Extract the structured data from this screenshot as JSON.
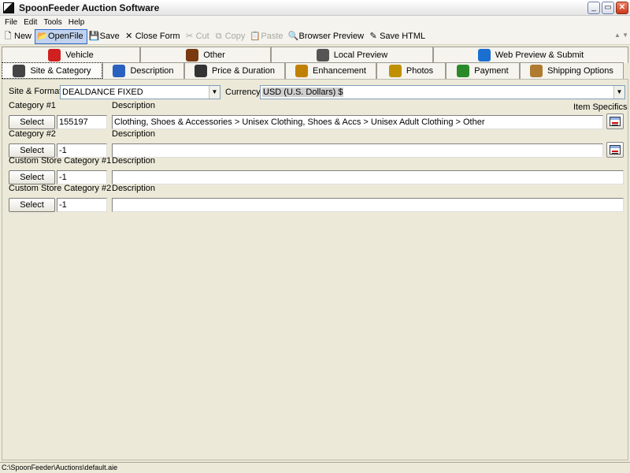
{
  "window": {
    "title": "SpoonFeeder Auction Software",
    "controls": [
      "_",
      "▭",
      "✕"
    ]
  },
  "menu": [
    "File",
    "Edit",
    "Tools",
    "Help"
  ],
  "toolbar": {
    "items": [
      {
        "label": "New",
        "icon": "new-document-icon",
        "glyph": "🗋",
        "state": "normal"
      },
      {
        "label": "OpenFile",
        "icon": "open-folder-icon",
        "glyph": "📂",
        "state": "active"
      },
      {
        "label": "Save",
        "icon": "save-disk-icon",
        "glyph": "💾",
        "state": "normal"
      },
      {
        "label": "Close Form",
        "icon": "close-x-icon",
        "glyph": "✕",
        "state": "normal"
      },
      {
        "label": "Cut",
        "icon": "scissors-icon",
        "glyph": "✂",
        "state": "disabled"
      },
      {
        "label": "Copy",
        "icon": "copy-icon",
        "glyph": "⧉",
        "state": "disabled"
      },
      {
        "label": "Paste",
        "icon": "paste-icon",
        "glyph": "📋",
        "state": "disabled"
      },
      {
        "label": "Browser Preview",
        "icon": "browser-preview-icon",
        "glyph": "🔍",
        "state": "normal"
      },
      {
        "label": "Save HTML",
        "icon": "save-html-icon",
        "glyph": "✎",
        "state": "normal"
      }
    ]
  },
  "tabs_row1": [
    {
      "label": "Vehicle",
      "icon": "car-icon",
      "color": "#d02020"
    },
    {
      "label": "Other",
      "icon": "barcode-icon",
      "color": "#7a3a10"
    },
    {
      "label": "Local Preview",
      "icon": "book-icon",
      "color": "#555555"
    },
    {
      "label": "Web Preview & Submit",
      "icon": "globe-icon",
      "color": "#1a6fd0"
    }
  ],
  "tabs_row2": [
    {
      "label": "Site & Category",
      "icon": "tree-icon",
      "color": "#444444",
      "selected": true
    },
    {
      "label": "Description",
      "icon": "edit-document-icon",
      "color": "#2a60c0",
      "selected": false
    },
    {
      "label": "Price & Duration",
      "icon": "clock-icon",
      "color": "#333333",
      "selected": false
    },
    {
      "label": "Enhancement",
      "icon": "magic-wand-icon",
      "color": "#c08000",
      "selected": false
    },
    {
      "label": "Photos",
      "icon": "photos-icon",
      "color": "#c09000",
      "selected": false
    },
    {
      "label": "Payment",
      "icon": "payment-icon",
      "color": "#2a8a2a",
      "selected": false
    },
    {
      "label": "Shipping Options",
      "icon": "package-icon",
      "color": "#b07a30",
      "selected": false
    }
  ],
  "site_format": {
    "label": "Site & Format",
    "value": "DEALDANCE FIXED"
  },
  "currency": {
    "label": "Currency",
    "value": "USD (U.S. Dollars) $"
  },
  "item_specifics_label": "Item Specifics",
  "categories": [
    {
      "label": "Category #1",
      "button": "Select",
      "id": "155197",
      "desc_label": "Description",
      "description": "Clothing, Shoes & Accessories > Unisex Clothing, Shoes & Accs > Unisex Adult Clothing > Other",
      "has_specifics": true
    },
    {
      "label": "Category #2",
      "button": "Select",
      "id": "-1",
      "desc_label": "Description",
      "description": "",
      "has_specifics": true
    },
    {
      "label": "Custom Store Category #1",
      "button": "Select",
      "id": "-1",
      "desc_label": "Description",
      "description": "",
      "has_specifics": false
    },
    {
      "label": "Custom Store Category #2",
      "button": "Select",
      "id": "-1",
      "desc_label": "Description",
      "description": "",
      "has_specifics": false
    }
  ],
  "status": {
    "path": "C:\\SpoonFeeder\\Auctions\\default.aie"
  }
}
